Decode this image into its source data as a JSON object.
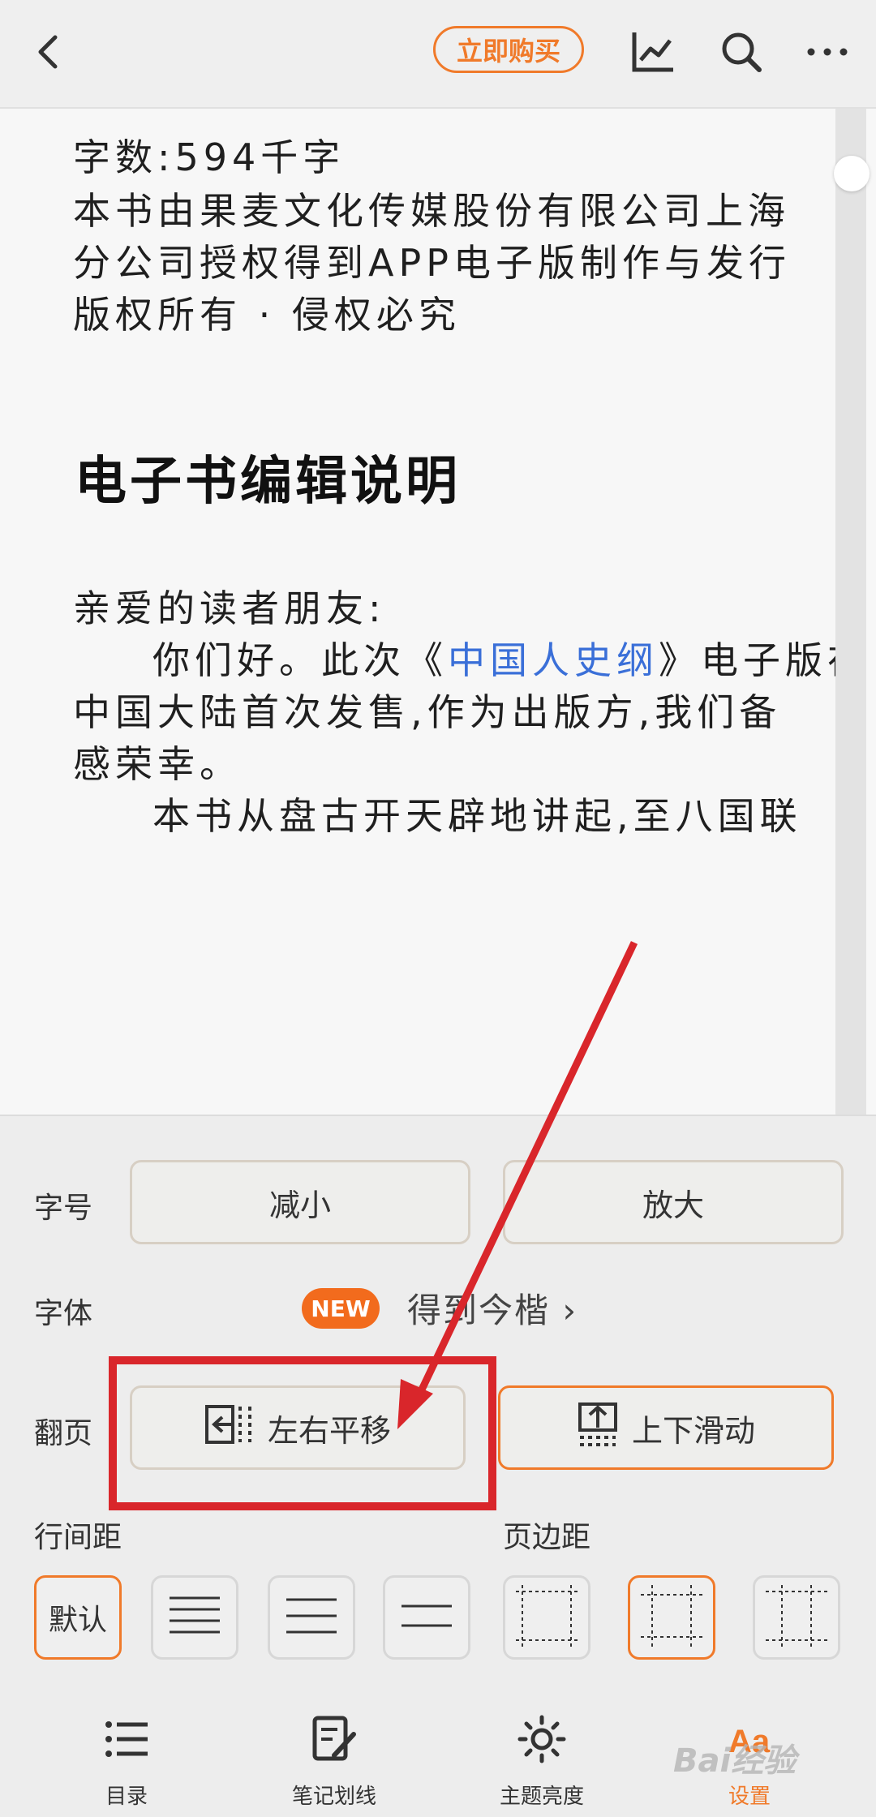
{
  "header": {
    "buy_label": "立即购买",
    "icons": [
      "back-icon",
      "chart-icon",
      "search-icon",
      "more-icon"
    ]
  },
  "reader": {
    "lines": [
      "字数:594千字",
      "本书由果麦文化传媒股份有限公司上海",
      "分公司授权得到APP电子版制作与发行",
      "版权所有 · 侵权必究"
    ],
    "heading": "电子书编辑说明",
    "greeting": "亲爱的读者朋友:",
    "para1_prefix": "你们好。此次《",
    "para1_link": "中国人史纲",
    "para1_suffix": "》电子版在",
    "para1_line2": "中国大陆首次发售,作为出版方,我们备",
    "para1_line3": "感荣幸。",
    "para2_line1": "本书从盘古开天辟地讲起,至八国联"
  },
  "settings": {
    "font_size_label": "字号",
    "decrease_label": "减小",
    "increase_label": "放大",
    "font_label": "字体",
    "new_badge": "NEW",
    "font_name": "得到今楷 ›",
    "page_turn_label": "翻页",
    "page_turn_horizontal": "左右平移",
    "page_turn_vertical": "上下滑动",
    "line_spacing_label": "行间距",
    "margin_label": "页边距",
    "default_label": "默认"
  },
  "nav": {
    "toc": "目录",
    "notes": "笔记划线",
    "theme": "主题亮度",
    "settings": "设置"
  },
  "colors": {
    "accent": "#f07a2a",
    "link": "#3a6fd8",
    "annotation": "#d9262b"
  },
  "watermark": "Bai经验"
}
